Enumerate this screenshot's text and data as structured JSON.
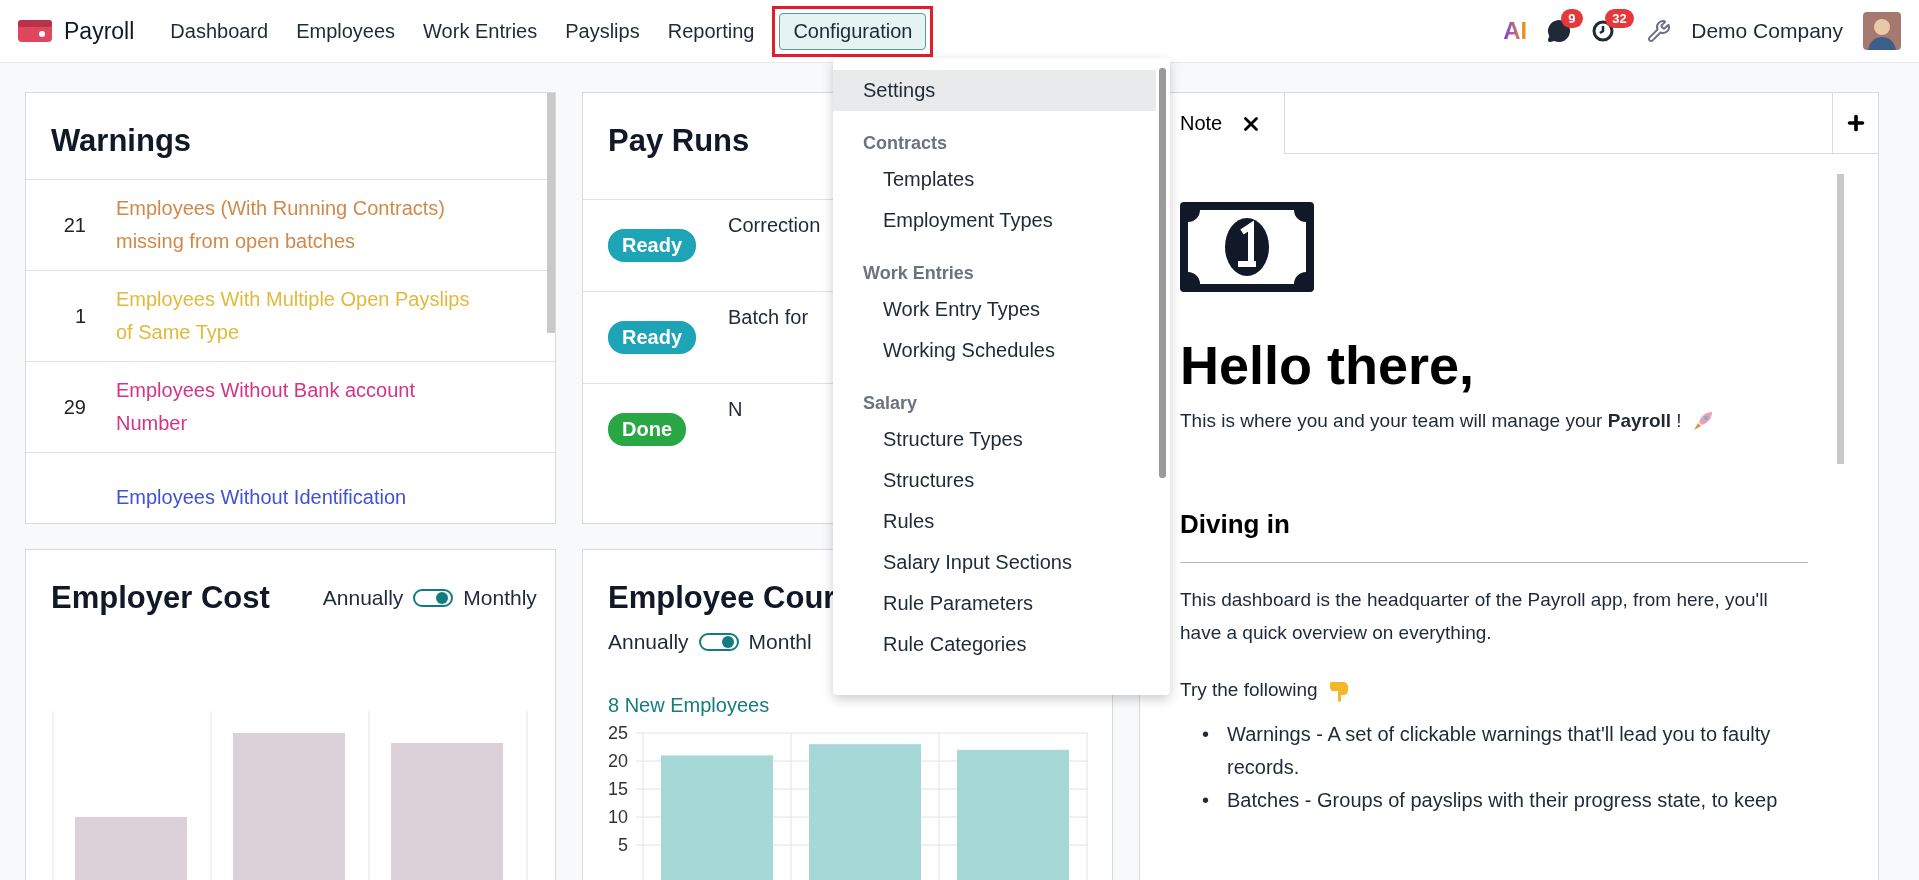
{
  "navbar": {
    "app": "Payroll",
    "menu": [
      {
        "label": "Dashboard",
        "selected": false
      },
      {
        "label": "Employees",
        "selected": false
      },
      {
        "label": "Work Entries",
        "selected": false
      },
      {
        "label": "Payslips",
        "selected": false
      },
      {
        "label": "Reporting",
        "selected": false
      },
      {
        "label": "Configuration",
        "selected": true
      }
    ],
    "ai_label": "AI",
    "messages_count": "9",
    "activities_count": "32",
    "company": "Demo Company"
  },
  "config_menu": {
    "items": [
      {
        "kind": "item",
        "label": "Settings",
        "highlighted": true
      },
      {
        "kind": "header",
        "label": "Contracts"
      },
      {
        "kind": "subitem",
        "label": "Templates",
        "highlighted": false
      },
      {
        "kind": "subitem",
        "label": "Employment Types",
        "highlighted": false
      },
      {
        "kind": "header",
        "label": "Work Entries"
      },
      {
        "kind": "subitem",
        "label": "Work Entry Types",
        "highlighted": false
      },
      {
        "kind": "subitem",
        "label": "Working Schedules",
        "highlighted": false
      },
      {
        "kind": "header",
        "label": "Salary"
      },
      {
        "kind": "subitem",
        "label": "Structure Types",
        "highlighted": false
      },
      {
        "kind": "subitem",
        "label": "Structures",
        "highlighted": false
      },
      {
        "kind": "subitem",
        "label": "Rules",
        "highlighted": false
      },
      {
        "kind": "subitem",
        "label": "Salary Input Sections",
        "highlighted": false
      },
      {
        "kind": "subitem",
        "label": "Rule Parameters",
        "highlighted": false
      },
      {
        "kind": "subitem",
        "label": "Rule Categories",
        "highlighted": false
      }
    ]
  },
  "warnings": {
    "title": "Warnings",
    "rows": [
      {
        "count": "21",
        "text": "Employees (With Running Contracts) missing from open batches",
        "color": "#d1894a"
      },
      {
        "count": "1",
        "text": "Employees With Multiple Open Payslips of Same Type",
        "color": "#e2b93b"
      },
      {
        "count": "29",
        "text": "Employees Without Bank account Number",
        "color": "#d63384"
      },
      {
        "text": "Employees Without Identification",
        "color": "#3f51d4"
      }
    ]
  },
  "pay_runs": {
    "title": "Pay Runs",
    "rows": [
      {
        "status": "Ready",
        "kind": "ready",
        "name": "Correction"
      },
      {
        "status": "Ready",
        "kind": "ready",
        "name": "Batch for"
      },
      {
        "status": "Done",
        "kind": "done",
        "name": "N"
      }
    ]
  },
  "employer_cost": {
    "title": "Employer Cost",
    "toggle": {
      "left": "Annually",
      "right": "Monthly",
      "on": true
    }
  },
  "employee_count": {
    "title": "Employee Cour",
    "toggle": {
      "left": "Annually",
      "right": "Monthl",
      "on": true
    },
    "link": "8 New Employees",
    "chart_data": {
      "type": "bar",
      "values": [
        21,
        23,
        22
      ],
      "ylim": [
        0,
        25
      ],
      "yticks": [
        5,
        10,
        15,
        20,
        25
      ],
      "grid": true
    }
  },
  "note": {
    "tabs": [
      {
        "label": "Note",
        "selected": true
      }
    ],
    "heading": "Hello there,",
    "intro": "This is where you and your team will manage your **Payroll** !",
    "subheading": "Diving in",
    "paragraph": "This dashboard is the headquarter of the Payroll app, from here, you'll have a quick overview on everything.",
    "try": "Try the following",
    "bullets": [
      {
        "marker": "•",
        "text": "Warnings - A set of clickable warnings that'll lead you to faulty records."
      },
      {
        "marker": "•",
        "text": "Batches - Groups of payslips with their progress state, to keep"
      }
    ]
  }
}
